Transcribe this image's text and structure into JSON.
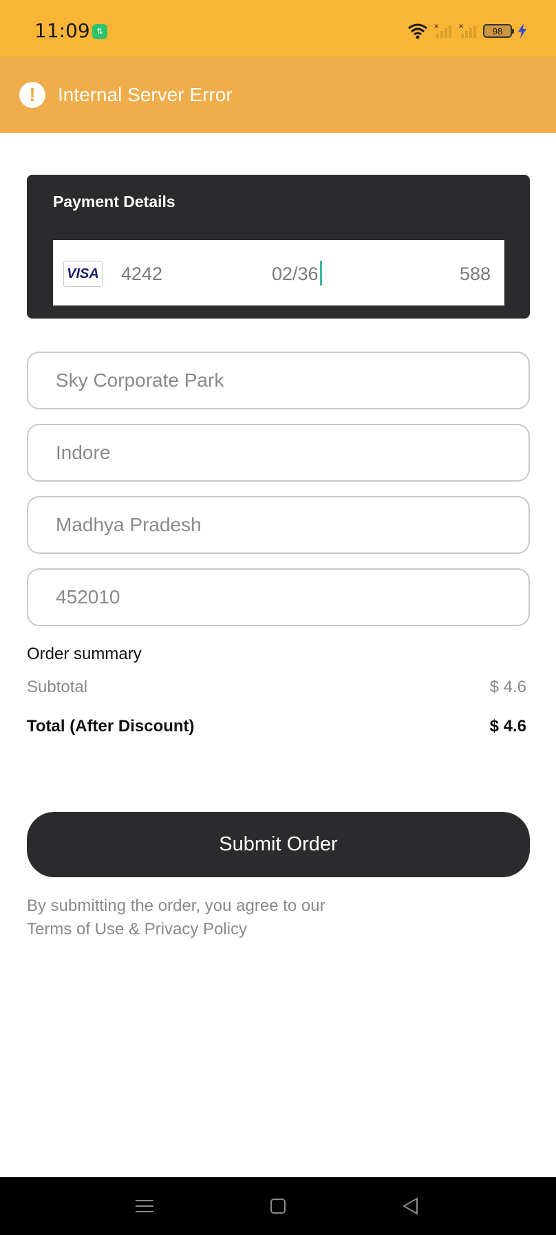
{
  "status_bar": {
    "time": "11:09",
    "app_badge": "⇅",
    "battery": "98",
    "colors": {
      "background": "#f9b535"
    }
  },
  "error_banner": {
    "text": "Internal Server Error",
    "icon": "exclamation-icon",
    "colors": {
      "background": "#efad4c"
    }
  },
  "payment": {
    "title": "Payment Details",
    "card_brand": "VISA",
    "card_number": "4242",
    "expiry": "02/36",
    "cvc": "588",
    "colors": {
      "card_bg": "#2b2b2d"
    }
  },
  "address": {
    "line1": "Sky Corporate Park",
    "city": "Indore",
    "state": "Madhya Pradesh",
    "zip": "452010"
  },
  "order_summary": {
    "title": "Order summary",
    "subtotal_label": "Subtotal",
    "subtotal_value": "$ 4.6",
    "total_label": "Total (After Discount)",
    "total_value": "$ 4.6"
  },
  "submit_label": "Submit Order",
  "terms": {
    "line1": "By submitting the order, you agree to our",
    "link": "Terms of Use & Privacy Policy"
  },
  "nav": {
    "icons": [
      "menu-icon",
      "home-icon",
      "back-icon"
    ]
  }
}
